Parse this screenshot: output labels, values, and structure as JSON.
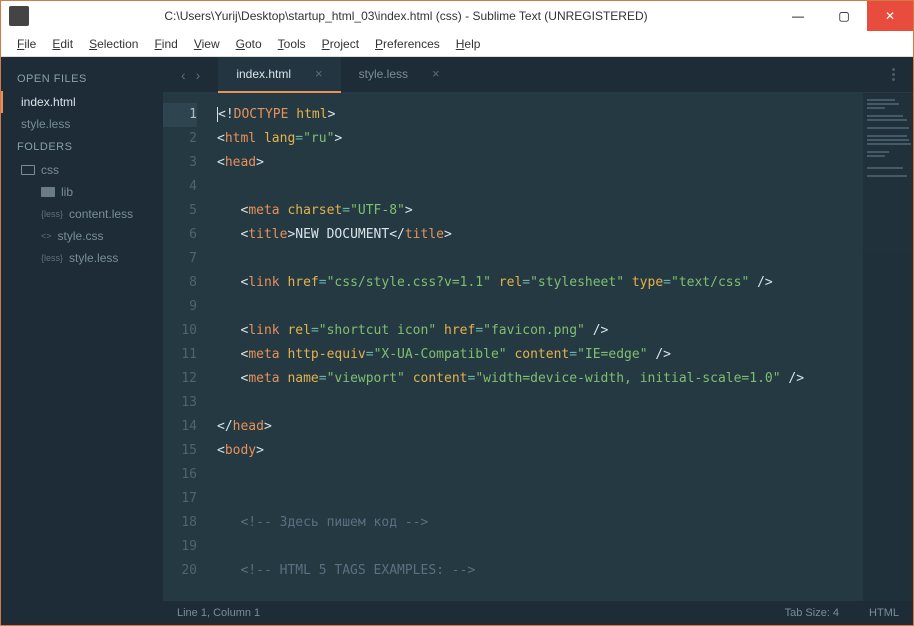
{
  "window": {
    "title": "C:\\Users\\Yurij\\Desktop\\startup_html_03\\index.html (css) - Sublime Text (UNREGISTERED)"
  },
  "menubar": [
    "File",
    "Edit",
    "Selection",
    "Find",
    "View",
    "Goto",
    "Tools",
    "Project",
    "Preferences",
    "Help"
  ],
  "sidebar": {
    "open_files_heading": "OPEN FILES",
    "open_files": [
      {
        "label": "index.html",
        "active": true
      },
      {
        "label": "style.less",
        "active": false
      }
    ],
    "folders_heading": "FOLDERS",
    "tree": {
      "root": "css",
      "children": [
        {
          "type": "folder",
          "label": "lib"
        },
        {
          "type": "file",
          "prefix": "{less}",
          "label": "content.less"
        },
        {
          "type": "file",
          "prefix": "<>",
          "label": "style.css"
        },
        {
          "type": "file",
          "prefix": "{less}",
          "label": "style.less"
        }
      ]
    }
  },
  "tabs": [
    {
      "label": "index.html",
      "active": true
    },
    {
      "label": "style.less",
      "active": false
    }
  ],
  "code_lines": [
    {
      "n": 1,
      "html": "<span class='tok-bracket'>&lt;!</span><span class='tok-decl'>DOCTYPE</span> <span class='tok-attr'>html</span><span class='tok-bracket'>&gt;</span>"
    },
    {
      "n": 2,
      "html": "<span class='tok-bracket'>&lt;</span><span class='tok-tag'>html</span> <span class='tok-attr'>lang</span><span class='tok-punct'>=</span><span class='tok-str'>\"ru\"</span><span class='tok-bracket'>&gt;</span>"
    },
    {
      "n": 3,
      "html": "<span class='tok-bracket'>&lt;</span><span class='tok-tag'>head</span><span class='tok-bracket'>&gt;</span>"
    },
    {
      "n": 4,
      "html": ""
    },
    {
      "n": 5,
      "html": "   <span class='tok-bracket'>&lt;</span><span class='tok-tag'>meta</span> <span class='tok-attr'>charset</span><span class='tok-punct'>=</span><span class='tok-str'>\"UTF-8\"</span><span class='tok-bracket'>&gt;</span>"
    },
    {
      "n": 6,
      "html": "   <span class='tok-bracket'>&lt;</span><span class='tok-tag'>title</span><span class='tok-bracket'>&gt;</span><span class='tok-text'>NEW DOCUMENT</span><span class='tok-bracket'>&lt;/</span><span class='tok-tag'>title</span><span class='tok-bracket'>&gt;</span>"
    },
    {
      "n": 7,
      "html": ""
    },
    {
      "n": 8,
      "html": "   <span class='tok-bracket'>&lt;</span><span class='tok-tag'>link</span> <span class='tok-attr'>href</span><span class='tok-punct'>=</span><span class='tok-str'>\"css/style.css?v=1.1\"</span> <span class='tok-attr'>rel</span><span class='tok-punct'>=</span><span class='tok-str'>\"stylesheet\"</span> <span class='tok-attr'>type</span><span class='tok-punct'>=</span><span class='tok-str'>\"text/css\"</span> <span class='tok-bracket'>/&gt;</span>"
    },
    {
      "n": 9,
      "html": ""
    },
    {
      "n": 10,
      "html": "   <span class='tok-bracket'>&lt;</span><span class='tok-tag'>link</span> <span class='tok-attr'>rel</span><span class='tok-punct'>=</span><span class='tok-str'>\"shortcut icon\"</span> <span class='tok-attr'>href</span><span class='tok-punct'>=</span><span class='tok-str'>\"favicon.png\"</span> <span class='tok-bracket'>/&gt;</span>"
    },
    {
      "n": 11,
      "html": "   <span class='tok-bracket'>&lt;</span><span class='tok-tag'>meta</span> <span class='tok-attr'>http-equiv</span><span class='tok-punct'>=</span><span class='tok-str'>\"X-UA-Compatible\"</span> <span class='tok-attr'>content</span><span class='tok-punct'>=</span><span class='tok-str'>\"IE=edge\"</span> <span class='tok-bracket'>/&gt;</span>"
    },
    {
      "n": 12,
      "html": "   <span class='tok-bracket'>&lt;</span><span class='tok-tag'>meta</span> <span class='tok-attr'>name</span><span class='tok-punct'>=</span><span class='tok-str'>\"viewport\"</span> <span class='tok-attr'>content</span><span class='tok-punct'>=</span><span class='tok-str'>\"width=device-width, initial-scale=1.0\"</span> <span class='tok-bracket'>/&gt;</span>"
    },
    {
      "n": 13,
      "html": ""
    },
    {
      "n": 14,
      "html": "<span class='tok-bracket'>&lt;/</span><span class='tok-tag'>head</span><span class='tok-bracket'>&gt;</span>"
    },
    {
      "n": 15,
      "html": "<span class='tok-bracket'>&lt;</span><span class='tok-tag'>body</span><span class='tok-bracket'>&gt;</span>"
    },
    {
      "n": 16,
      "html": ""
    },
    {
      "n": 17,
      "html": ""
    },
    {
      "n": 18,
      "html": "   <span class='tok-comment'>&lt;!-- Здесь пишем код --&gt;</span>"
    },
    {
      "n": 19,
      "html": ""
    },
    {
      "n": 20,
      "html": "   <span class='tok-comment'>&lt;!-- HTML 5 TAGS EXAMPLES: --&gt;</span>"
    }
  ],
  "statusbar": {
    "left": "Line 1, Column 1",
    "tab_size": "Tab Size: 4",
    "lang": "HTML"
  }
}
